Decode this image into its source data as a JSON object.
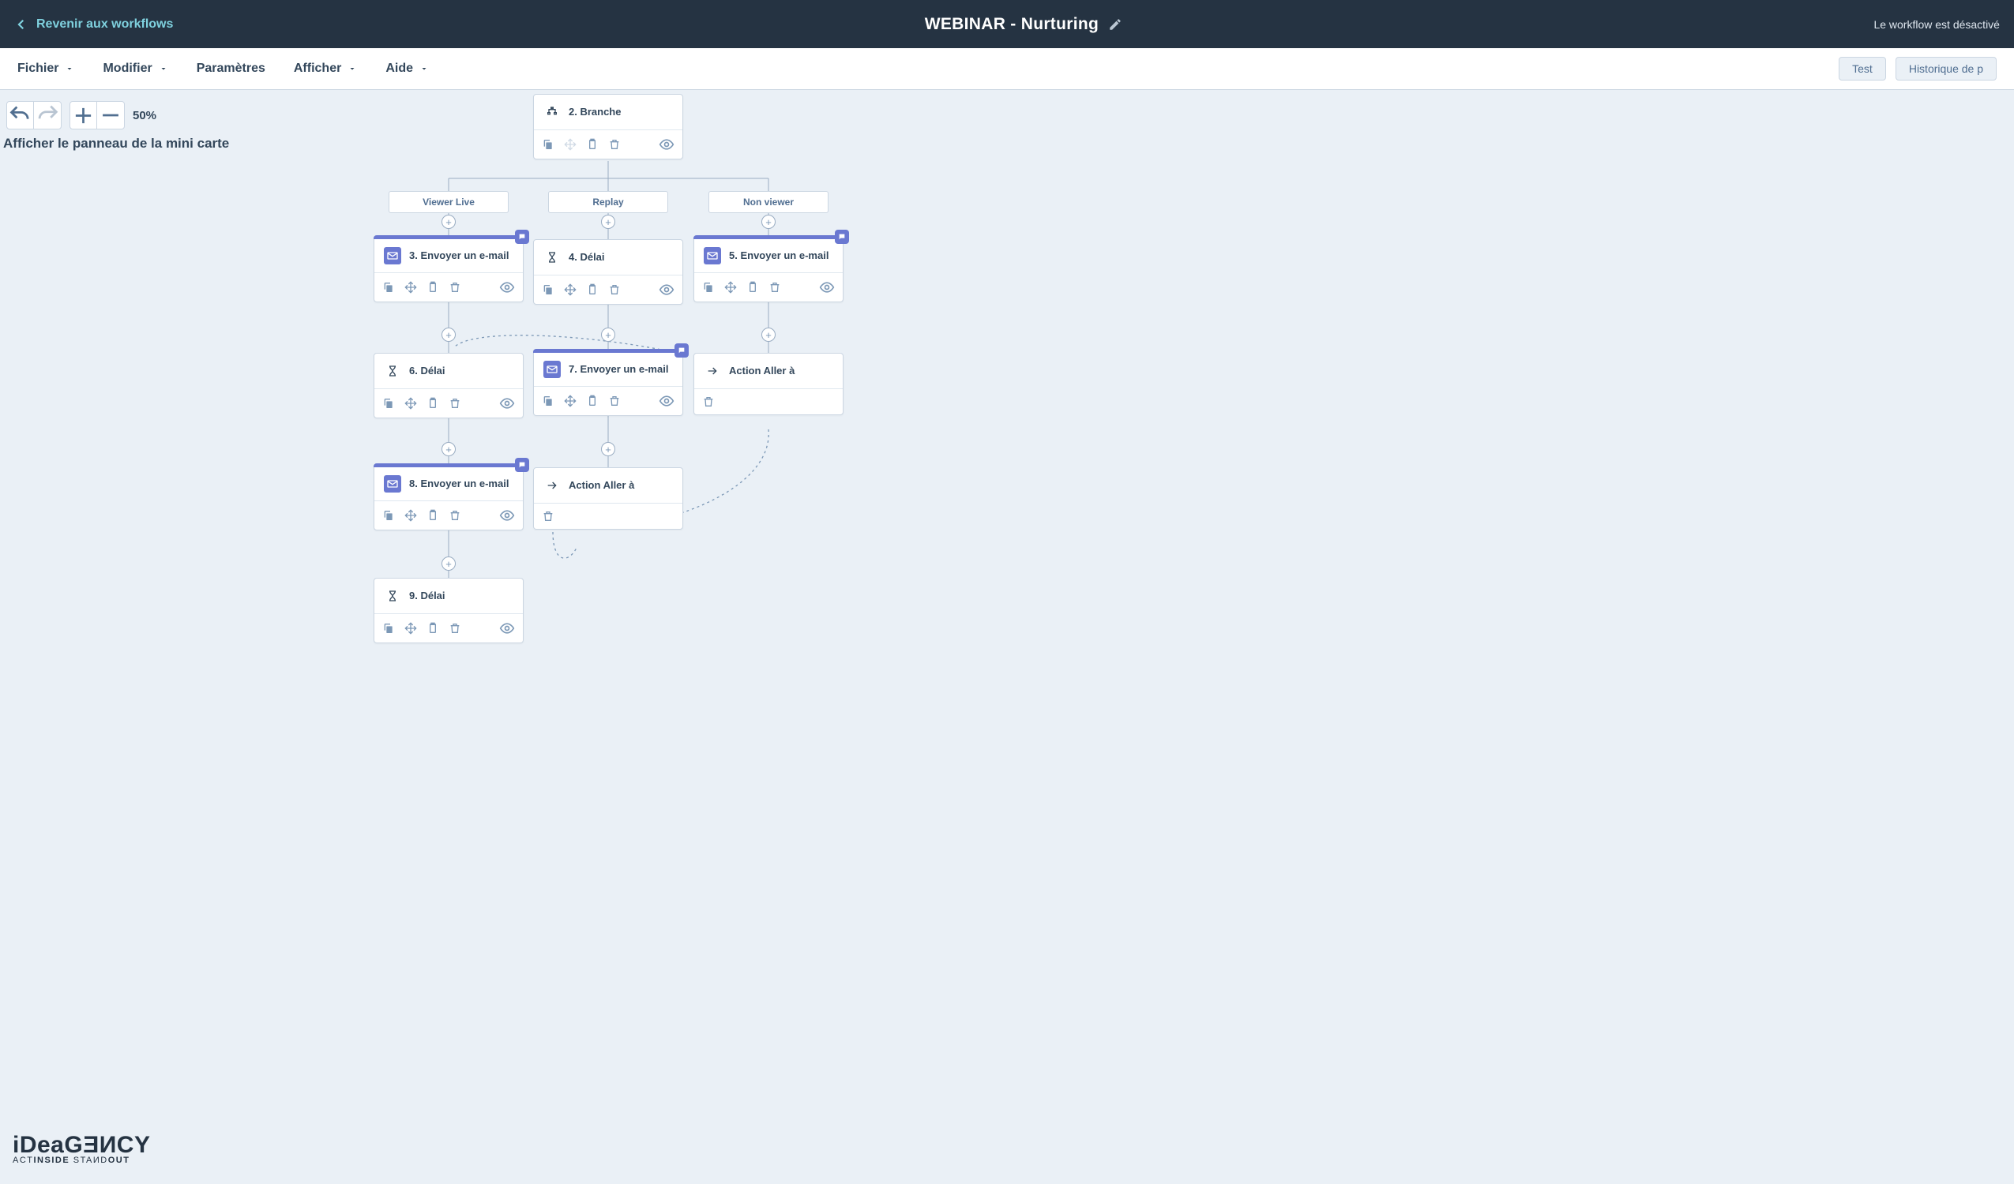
{
  "topbar": {
    "back_label": "Revenir aux workflows",
    "title": "WEBINAR - Nurturing",
    "status": "Le workflow est désactivé"
  },
  "menu": {
    "fichier": "Fichier",
    "modifier": "Modifier",
    "parametres": "Paramètres",
    "afficher": "Afficher",
    "aide": "Aide",
    "test": "Test",
    "historique": "Historique de p"
  },
  "toolbar": {
    "zoom": "50%",
    "minimap": "Afficher le panneau de la mini carte"
  },
  "logo": {
    "line1": "iDeaGƎИCY",
    "line2_a": "ACT",
    "line2_b": "INSIDE",
    "line2_c": "STAИD",
    "line2_d": "OUT"
  },
  "branches": {
    "b1": "Viewer Live",
    "b2": "Replay",
    "b3": "Non viewer"
  },
  "nodes": {
    "branch": "2. Branche",
    "n3": "3. Envoyer un e-mail",
    "n4": "4. Délai",
    "n5": "5. Envoyer un e-mail",
    "n6": "6. Délai",
    "n7": "7. Envoyer un e-mail",
    "goto_a": "Action Aller à",
    "n8": "8. Envoyer un e-mail",
    "goto_b": "Action Aller à",
    "n9": "9. Délai"
  }
}
